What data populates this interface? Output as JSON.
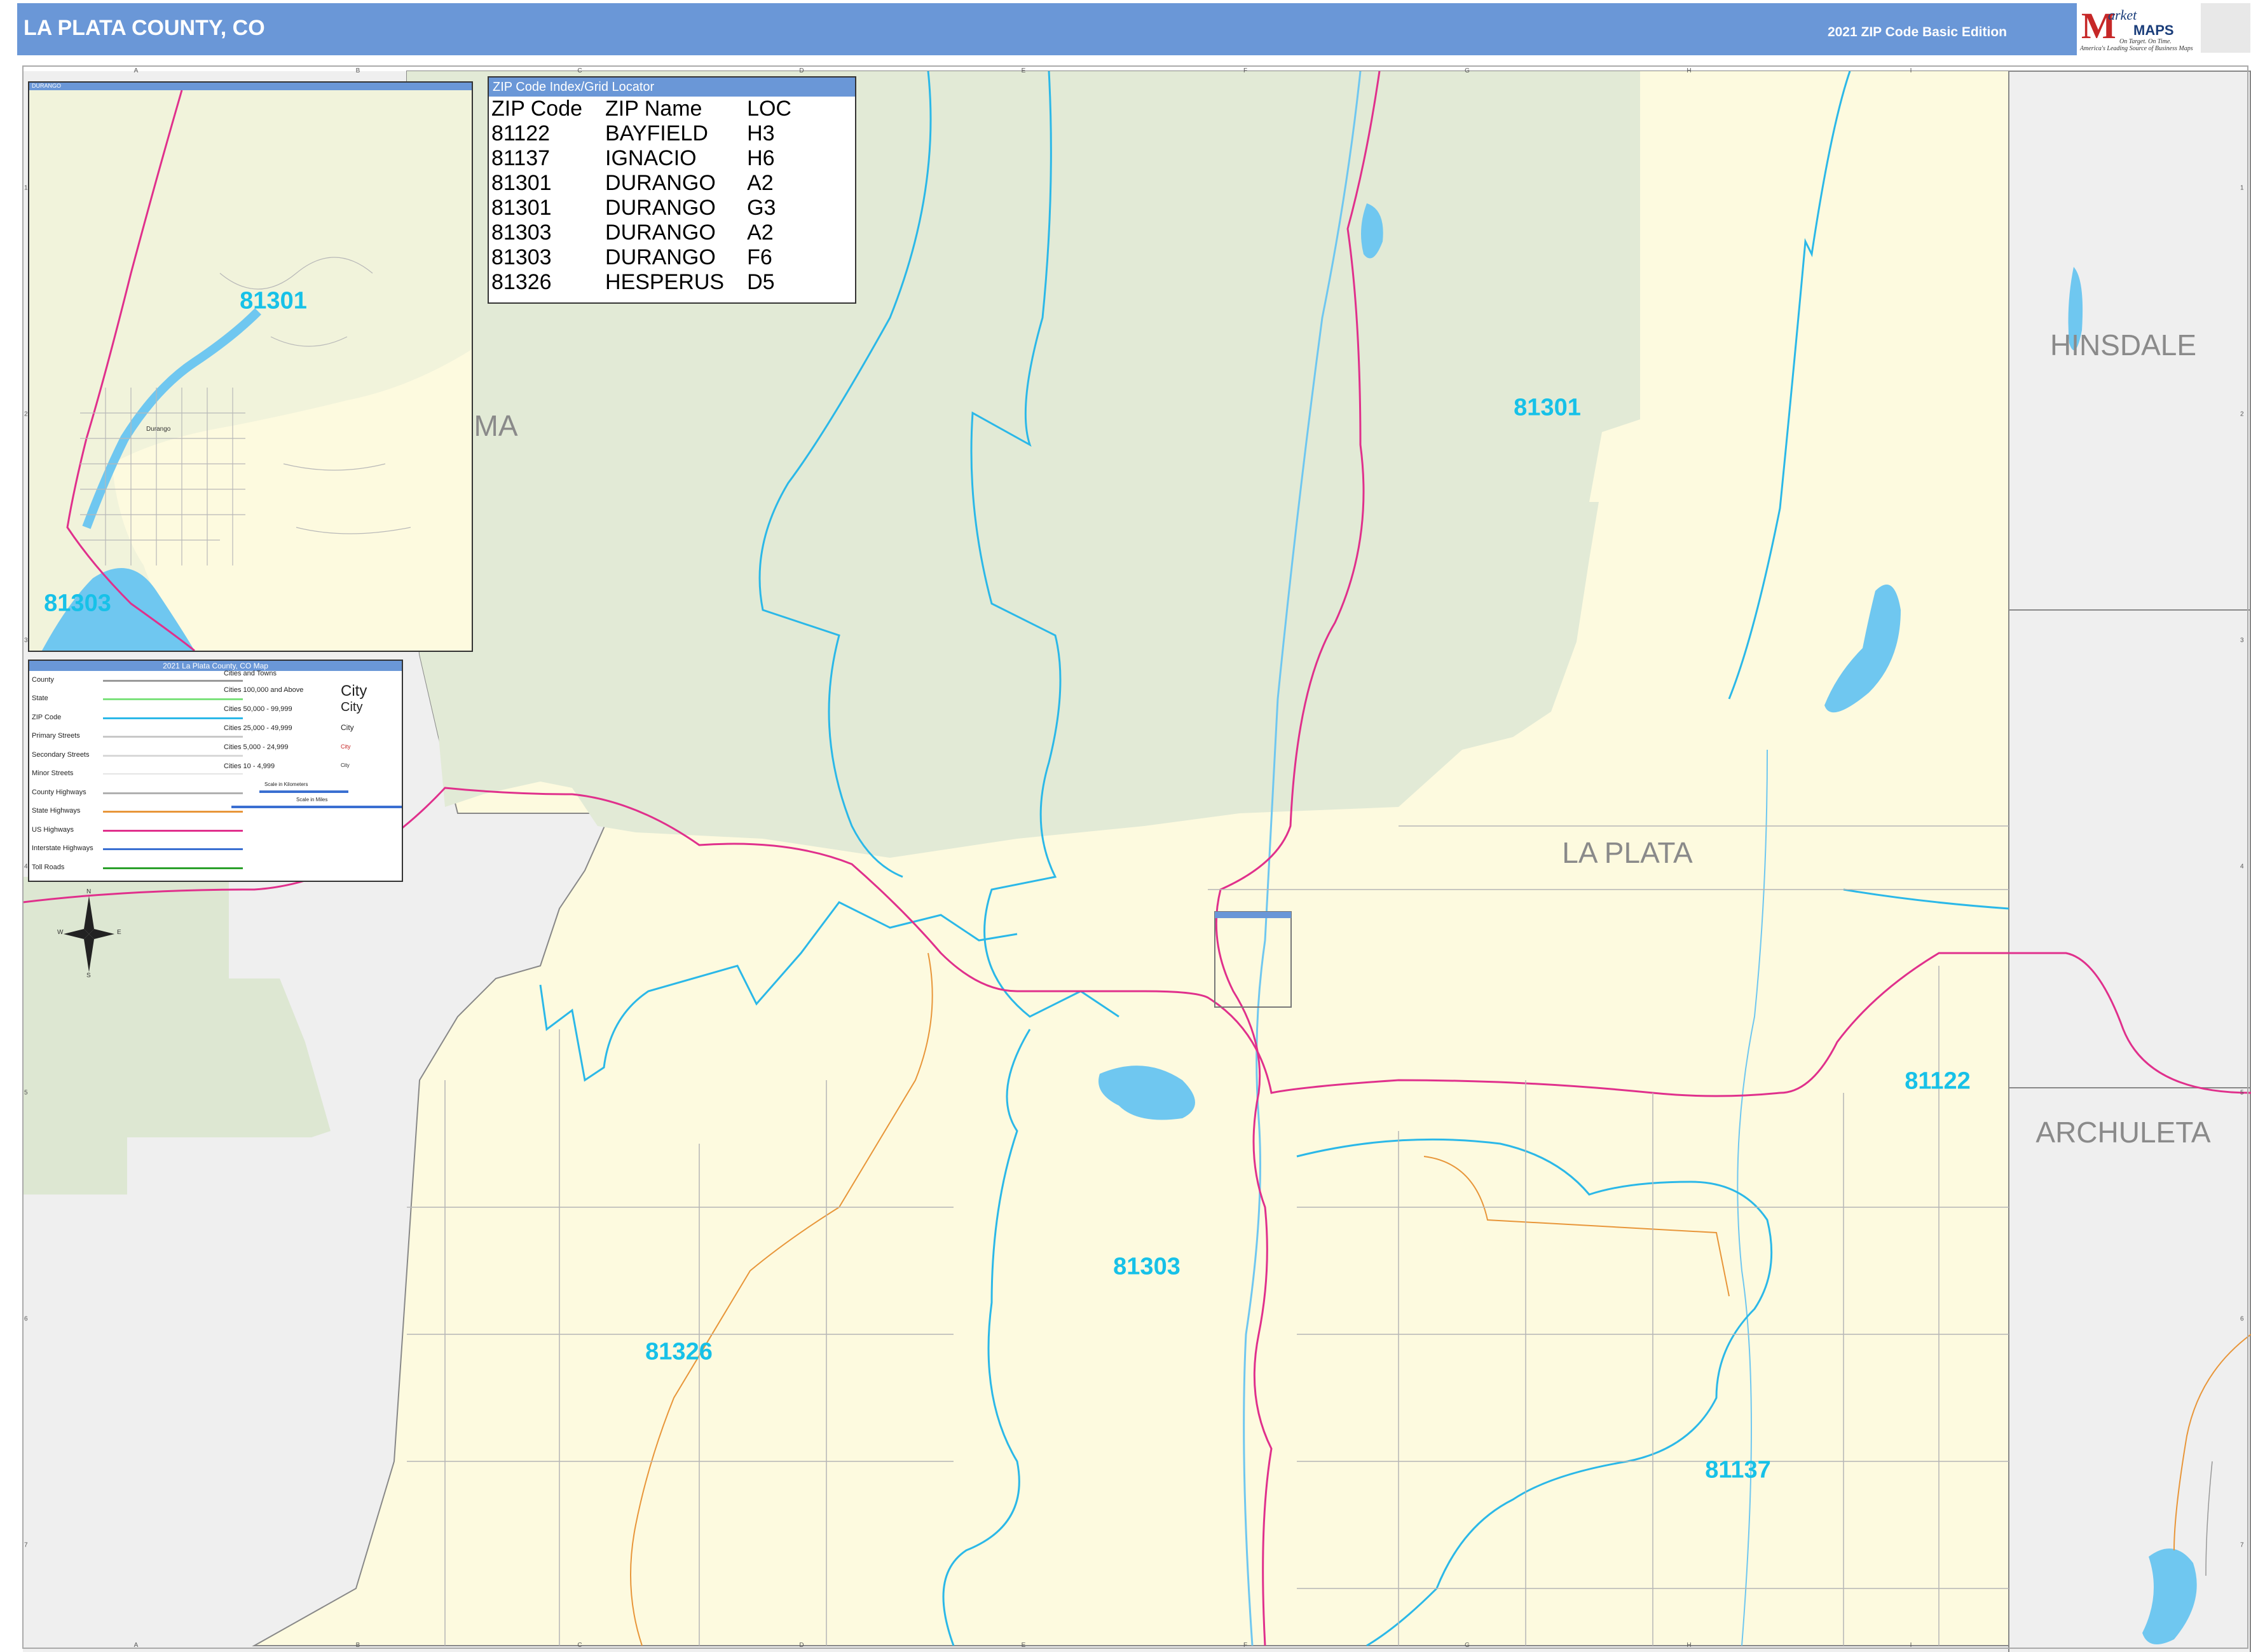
{
  "header": {
    "title": "LA PLATA COUNTY, CO",
    "edition": "2021 ZIP Code Basic Edition"
  },
  "logo": {
    "m": "M",
    "arket": "arket",
    "maps": "MAPS",
    "tagline1": "On Target. On Time.",
    "tagline2": "America's Leading Source of Business Maps"
  },
  "zip_index": {
    "title": "ZIP Code Index/Grid Locator",
    "columns": [
      "ZIP Code",
      "ZIP Name",
      "LOC"
    ],
    "rows": [
      [
        "81122",
        "BAYFIELD",
        "H3"
      ],
      [
        "81137",
        "IGNACIO",
        "H6"
      ],
      [
        "81301",
        "DURANGO",
        "A2"
      ],
      [
        "81301",
        "DURANGO",
        "G3"
      ],
      [
        "81303",
        "DURANGO",
        "A2"
      ],
      [
        "81303",
        "DURANGO",
        "F6"
      ],
      [
        "81326",
        "HESPERUS",
        "D5"
      ]
    ]
  },
  "inset": {
    "title": "DURANGO",
    "city": "Durango",
    "zip_labels": [
      "81301",
      "81303"
    ]
  },
  "main_zip_labels": [
    "81301",
    "81122",
    "81303",
    "81326",
    "81137"
  ],
  "county_labels": [
    "HINSDALE",
    "ARCHULETA",
    "LA PLATA",
    "MA"
  ],
  "grid": {
    "letters": [
      "A",
      "B",
      "C",
      "D",
      "E",
      "F",
      "G",
      "H",
      "I"
    ],
    "numbers": [
      "1",
      "2",
      "3",
      "4",
      "5",
      "6",
      "7"
    ]
  },
  "legend": {
    "title": "2021 La Plata County, CO Map",
    "items": [
      "County",
      "State",
      "ZIP Code",
      "Primary Streets",
      "Secondary Streets",
      "Minor Streets",
      "County Highways",
      "State Highways",
      "US Highways",
      "Interstate Highways",
      "Toll Roads"
    ],
    "cities_header": "Cities and Towns",
    "cities": [
      "Cities 100,000 and Above",
      "Cities 50,000 - 99,999",
      "Cities 25,000 - 49,999",
      "Cities 5,000 - 24,999",
      "Cities 10 - 4,999"
    ],
    "city_samples": [
      "City",
      "City",
      "City",
      "City",
      "City"
    ],
    "scale_km": "Scale in Kilometers",
    "scale_mi": "Scale in Miles"
  },
  "compass": {
    "n": "N",
    "s": "S",
    "e": "E",
    "w": "W"
  },
  "colors": {
    "header": "#6a97d7",
    "county_fill": "#fdfadf",
    "forest_fill": "#e2ead6",
    "outside_fill": "#efefef",
    "water": "#6fc7f0",
    "zip_boundary": "#2bb8e8",
    "us_highway": "#e0308c",
    "state_highway": "#e8963a",
    "zip_label": "#17c1e8"
  }
}
